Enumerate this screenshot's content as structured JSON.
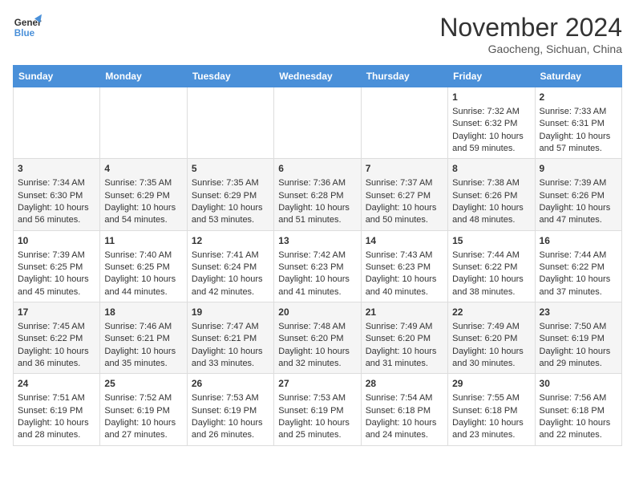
{
  "header": {
    "logo_line1": "General",
    "logo_line2": "Blue",
    "month_title": "November 2024",
    "location": "Gaocheng, Sichuan, China"
  },
  "days_of_week": [
    "Sunday",
    "Monday",
    "Tuesday",
    "Wednesday",
    "Thursday",
    "Friday",
    "Saturday"
  ],
  "weeks": [
    {
      "days": [
        {
          "num": "",
          "info": ""
        },
        {
          "num": "",
          "info": ""
        },
        {
          "num": "",
          "info": ""
        },
        {
          "num": "",
          "info": ""
        },
        {
          "num": "",
          "info": ""
        },
        {
          "num": "1",
          "info": "Sunrise: 7:32 AM\nSunset: 6:32 PM\nDaylight: 10 hours and 59 minutes."
        },
        {
          "num": "2",
          "info": "Sunrise: 7:33 AM\nSunset: 6:31 PM\nDaylight: 10 hours and 57 minutes."
        }
      ]
    },
    {
      "days": [
        {
          "num": "3",
          "info": "Sunrise: 7:34 AM\nSunset: 6:30 PM\nDaylight: 10 hours and 56 minutes."
        },
        {
          "num": "4",
          "info": "Sunrise: 7:35 AM\nSunset: 6:29 PM\nDaylight: 10 hours and 54 minutes."
        },
        {
          "num": "5",
          "info": "Sunrise: 7:35 AM\nSunset: 6:29 PM\nDaylight: 10 hours and 53 minutes."
        },
        {
          "num": "6",
          "info": "Sunrise: 7:36 AM\nSunset: 6:28 PM\nDaylight: 10 hours and 51 minutes."
        },
        {
          "num": "7",
          "info": "Sunrise: 7:37 AM\nSunset: 6:27 PM\nDaylight: 10 hours and 50 minutes."
        },
        {
          "num": "8",
          "info": "Sunrise: 7:38 AM\nSunset: 6:26 PM\nDaylight: 10 hours and 48 minutes."
        },
        {
          "num": "9",
          "info": "Sunrise: 7:39 AM\nSunset: 6:26 PM\nDaylight: 10 hours and 47 minutes."
        }
      ]
    },
    {
      "days": [
        {
          "num": "10",
          "info": "Sunrise: 7:39 AM\nSunset: 6:25 PM\nDaylight: 10 hours and 45 minutes."
        },
        {
          "num": "11",
          "info": "Sunrise: 7:40 AM\nSunset: 6:25 PM\nDaylight: 10 hours and 44 minutes."
        },
        {
          "num": "12",
          "info": "Sunrise: 7:41 AM\nSunset: 6:24 PM\nDaylight: 10 hours and 42 minutes."
        },
        {
          "num": "13",
          "info": "Sunrise: 7:42 AM\nSunset: 6:23 PM\nDaylight: 10 hours and 41 minutes."
        },
        {
          "num": "14",
          "info": "Sunrise: 7:43 AM\nSunset: 6:23 PM\nDaylight: 10 hours and 40 minutes."
        },
        {
          "num": "15",
          "info": "Sunrise: 7:44 AM\nSunset: 6:22 PM\nDaylight: 10 hours and 38 minutes."
        },
        {
          "num": "16",
          "info": "Sunrise: 7:44 AM\nSunset: 6:22 PM\nDaylight: 10 hours and 37 minutes."
        }
      ]
    },
    {
      "days": [
        {
          "num": "17",
          "info": "Sunrise: 7:45 AM\nSunset: 6:22 PM\nDaylight: 10 hours and 36 minutes."
        },
        {
          "num": "18",
          "info": "Sunrise: 7:46 AM\nSunset: 6:21 PM\nDaylight: 10 hours and 35 minutes."
        },
        {
          "num": "19",
          "info": "Sunrise: 7:47 AM\nSunset: 6:21 PM\nDaylight: 10 hours and 33 minutes."
        },
        {
          "num": "20",
          "info": "Sunrise: 7:48 AM\nSunset: 6:20 PM\nDaylight: 10 hours and 32 minutes."
        },
        {
          "num": "21",
          "info": "Sunrise: 7:49 AM\nSunset: 6:20 PM\nDaylight: 10 hours and 31 minutes."
        },
        {
          "num": "22",
          "info": "Sunrise: 7:49 AM\nSunset: 6:20 PM\nDaylight: 10 hours and 30 minutes."
        },
        {
          "num": "23",
          "info": "Sunrise: 7:50 AM\nSunset: 6:19 PM\nDaylight: 10 hours and 29 minutes."
        }
      ]
    },
    {
      "days": [
        {
          "num": "24",
          "info": "Sunrise: 7:51 AM\nSunset: 6:19 PM\nDaylight: 10 hours and 28 minutes."
        },
        {
          "num": "25",
          "info": "Sunrise: 7:52 AM\nSunset: 6:19 PM\nDaylight: 10 hours and 27 minutes."
        },
        {
          "num": "26",
          "info": "Sunrise: 7:53 AM\nSunset: 6:19 PM\nDaylight: 10 hours and 26 minutes."
        },
        {
          "num": "27",
          "info": "Sunrise: 7:53 AM\nSunset: 6:19 PM\nDaylight: 10 hours and 25 minutes."
        },
        {
          "num": "28",
          "info": "Sunrise: 7:54 AM\nSunset: 6:18 PM\nDaylight: 10 hours and 24 minutes."
        },
        {
          "num": "29",
          "info": "Sunrise: 7:55 AM\nSunset: 6:18 PM\nDaylight: 10 hours and 23 minutes."
        },
        {
          "num": "30",
          "info": "Sunrise: 7:56 AM\nSunset: 6:18 PM\nDaylight: 10 hours and 22 minutes."
        }
      ]
    }
  ]
}
